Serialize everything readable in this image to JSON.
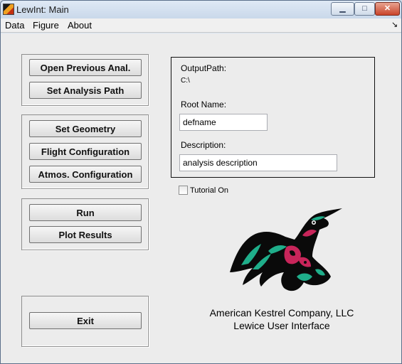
{
  "window": {
    "title": "LewInt: Main",
    "controls": {
      "minimize": "▁",
      "maximize": "□",
      "close": "✕"
    }
  },
  "menu": {
    "items": [
      "Data",
      "Figure",
      "About"
    ],
    "dock_arrow": "↘"
  },
  "buttons": {
    "open_previous": "Open Previous Anal.",
    "set_analysis_path": "Set Analysis Path",
    "set_geometry": "Set Geometry",
    "flight_configuration": "Flight Configuration",
    "atmos_configuration": "Atmos. Configuration",
    "run": "Run",
    "plot_results": "Plot Results",
    "exit": "Exit"
  },
  "output": {
    "path_label": "OutputPath:",
    "path_value": "C:\\",
    "root_label": "Root Name:",
    "root_value": "defname",
    "description_label": "Description:",
    "description_value": "analysis description"
  },
  "tutorial": {
    "label": "Tutorial On",
    "checked": false
  },
  "branding": {
    "company": "American Kestrel Company, LLC",
    "subtitle": "Lewice User Interface",
    "logo_icon": "kestrel-bird-logo",
    "colors": {
      "black": "#0a0a0a",
      "green": "#1fae8a",
      "red": "#c8255a"
    }
  }
}
